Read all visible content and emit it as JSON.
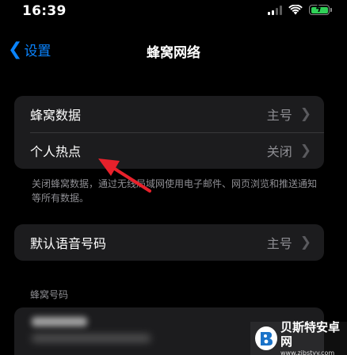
{
  "status_bar": {
    "time": "16:39",
    "battery_color": "#30d158"
  },
  "nav": {
    "back_label": "设置",
    "back_icon": "chevron-left-icon",
    "title": "蜂窝网络"
  },
  "group1": {
    "rows": [
      {
        "label": "蜂窝数据",
        "value": "主号"
      },
      {
        "label": "个人热点",
        "value": "关闭"
      }
    ]
  },
  "footnote": "关闭蜂窝数据，通过无线局域网使用电子邮件、网页浏览和推送通知等所有数据。",
  "group2": {
    "rows": [
      {
        "label": "默认语音号码",
        "value": "主号"
      }
    ]
  },
  "section_header": "蜂窝号码",
  "watermark": {
    "title": "贝斯特安卓网",
    "url": "www.zjbstyy.com"
  },
  "colors": {
    "accent": "#0a84ff",
    "annotation_arrow": "#e8212b",
    "card_background": "#1c1c1e",
    "secondary_text": "#8e8e93"
  }
}
